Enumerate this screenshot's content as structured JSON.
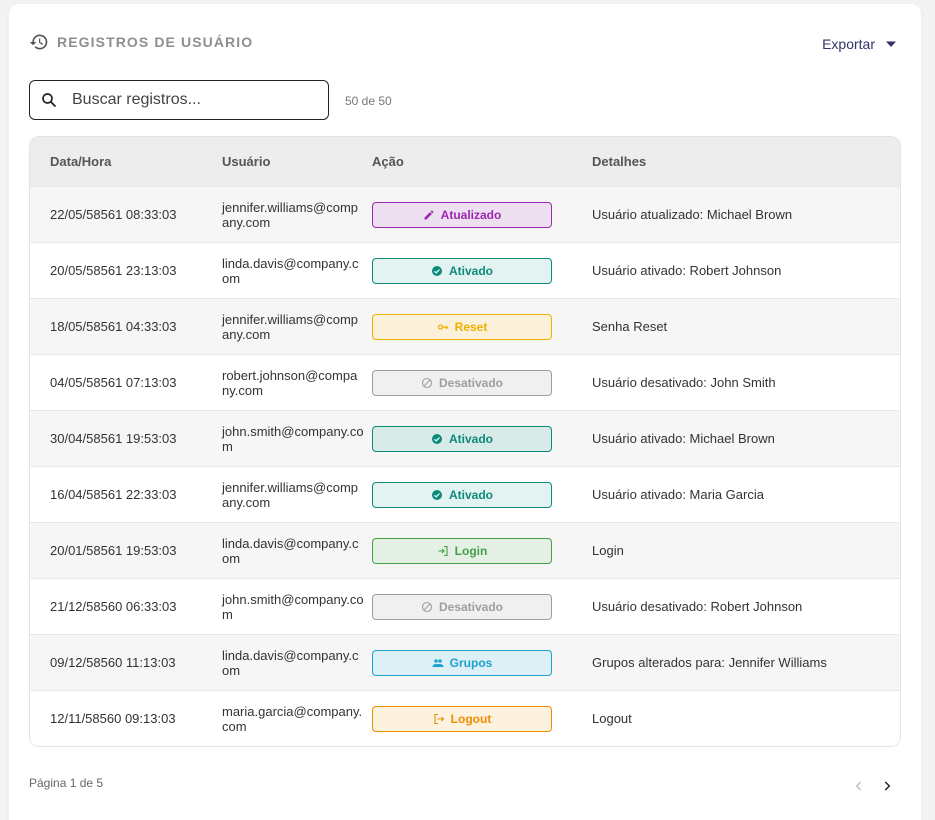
{
  "header": {
    "title": "REGISTROS DE USUÁRIO",
    "icon": "history-icon",
    "export_label": "Exportar"
  },
  "search": {
    "placeholder": "Buscar registros...",
    "value": ""
  },
  "count_text": "50 de 50",
  "table": {
    "columns": [
      "Data/Hora",
      "Usuário",
      "Ação",
      "Detalhes"
    ],
    "rows": [
      {
        "datetime": "22/05/58561 08:33:03",
        "user": "jennifer.williams@company.com",
        "action": "Atualizado",
        "action_icon": "pencil-icon",
        "action_color": "#9c27b0",
        "action_bg": "#ede0f0",
        "details": "Usuário atualizado: Michael Brown"
      },
      {
        "datetime": "20/05/58561 23:13:03",
        "user": "linda.davis@company.com",
        "action": "Ativado",
        "action_icon": "check-circle-icon",
        "action_color": "#0b8a7a",
        "action_bg": "#e3f3f1",
        "details": "Usuário ativado: Robert Johnson"
      },
      {
        "datetime": "18/05/58561 04:33:03",
        "user": "jennifer.williams@company.com",
        "action": "Reset",
        "action_icon": "key-icon",
        "action_color": "#f0b000",
        "action_bg": "#fbf1da",
        "details": "Senha Reset"
      },
      {
        "datetime": "04/05/58561 07:13:03",
        "user": "robert.johnson@company.com",
        "action": "Desativado",
        "action_icon": "block-icon",
        "action_color": "#9e9e9e",
        "action_bg": "#f0f0f0",
        "details": "Usuário desativado: John Smith"
      },
      {
        "datetime": "30/04/58561 19:53:03",
        "user": "john.smith@company.com",
        "action": "Ativado",
        "action_icon": "check-circle-icon",
        "action_color": "#0b8a7a",
        "action_bg": "#d8ebe9",
        "details": "Usuário ativado: Michael Brown"
      },
      {
        "datetime": "16/04/58561 22:33:03",
        "user": "jennifer.williams@company.com",
        "action": "Ativado",
        "action_icon": "check-circle-icon",
        "action_color": "#0b8a7a",
        "action_bg": "#e3f3f1",
        "details": "Usuário ativado: Maria Garcia"
      },
      {
        "datetime": "20/01/58561 19:53:03",
        "user": "linda.davis@company.com",
        "action": "Login",
        "action_icon": "login-icon",
        "action_color": "#43a047",
        "action_bg": "#e3f0e3",
        "details": "Login"
      },
      {
        "datetime": "21/12/58560 06:33:03",
        "user": "john.smith@company.com",
        "action": "Desativado",
        "action_icon": "block-icon",
        "action_color": "#9e9e9e",
        "action_bg": "#f0f0f0",
        "details": "Usuário desativado: Robert Johnson"
      },
      {
        "datetime": "09/12/58560 11:13:03",
        "user": "linda.davis@company.com",
        "action": "Grupos",
        "action_icon": "group-icon",
        "action_color": "#1aa3d1",
        "action_bg": "#ddf0f6",
        "details": "Grupos alterados para: Jennifer Williams"
      },
      {
        "datetime": "12/11/58560 09:13:03",
        "user": "maria.garcia@company.com",
        "action": "Logout",
        "action_icon": "logout-icon",
        "action_color": "#f08c00",
        "action_bg": "#fdf1e0",
        "details": "Logout"
      }
    ]
  },
  "footer": {
    "page_info": "Página 1 de 5"
  }
}
